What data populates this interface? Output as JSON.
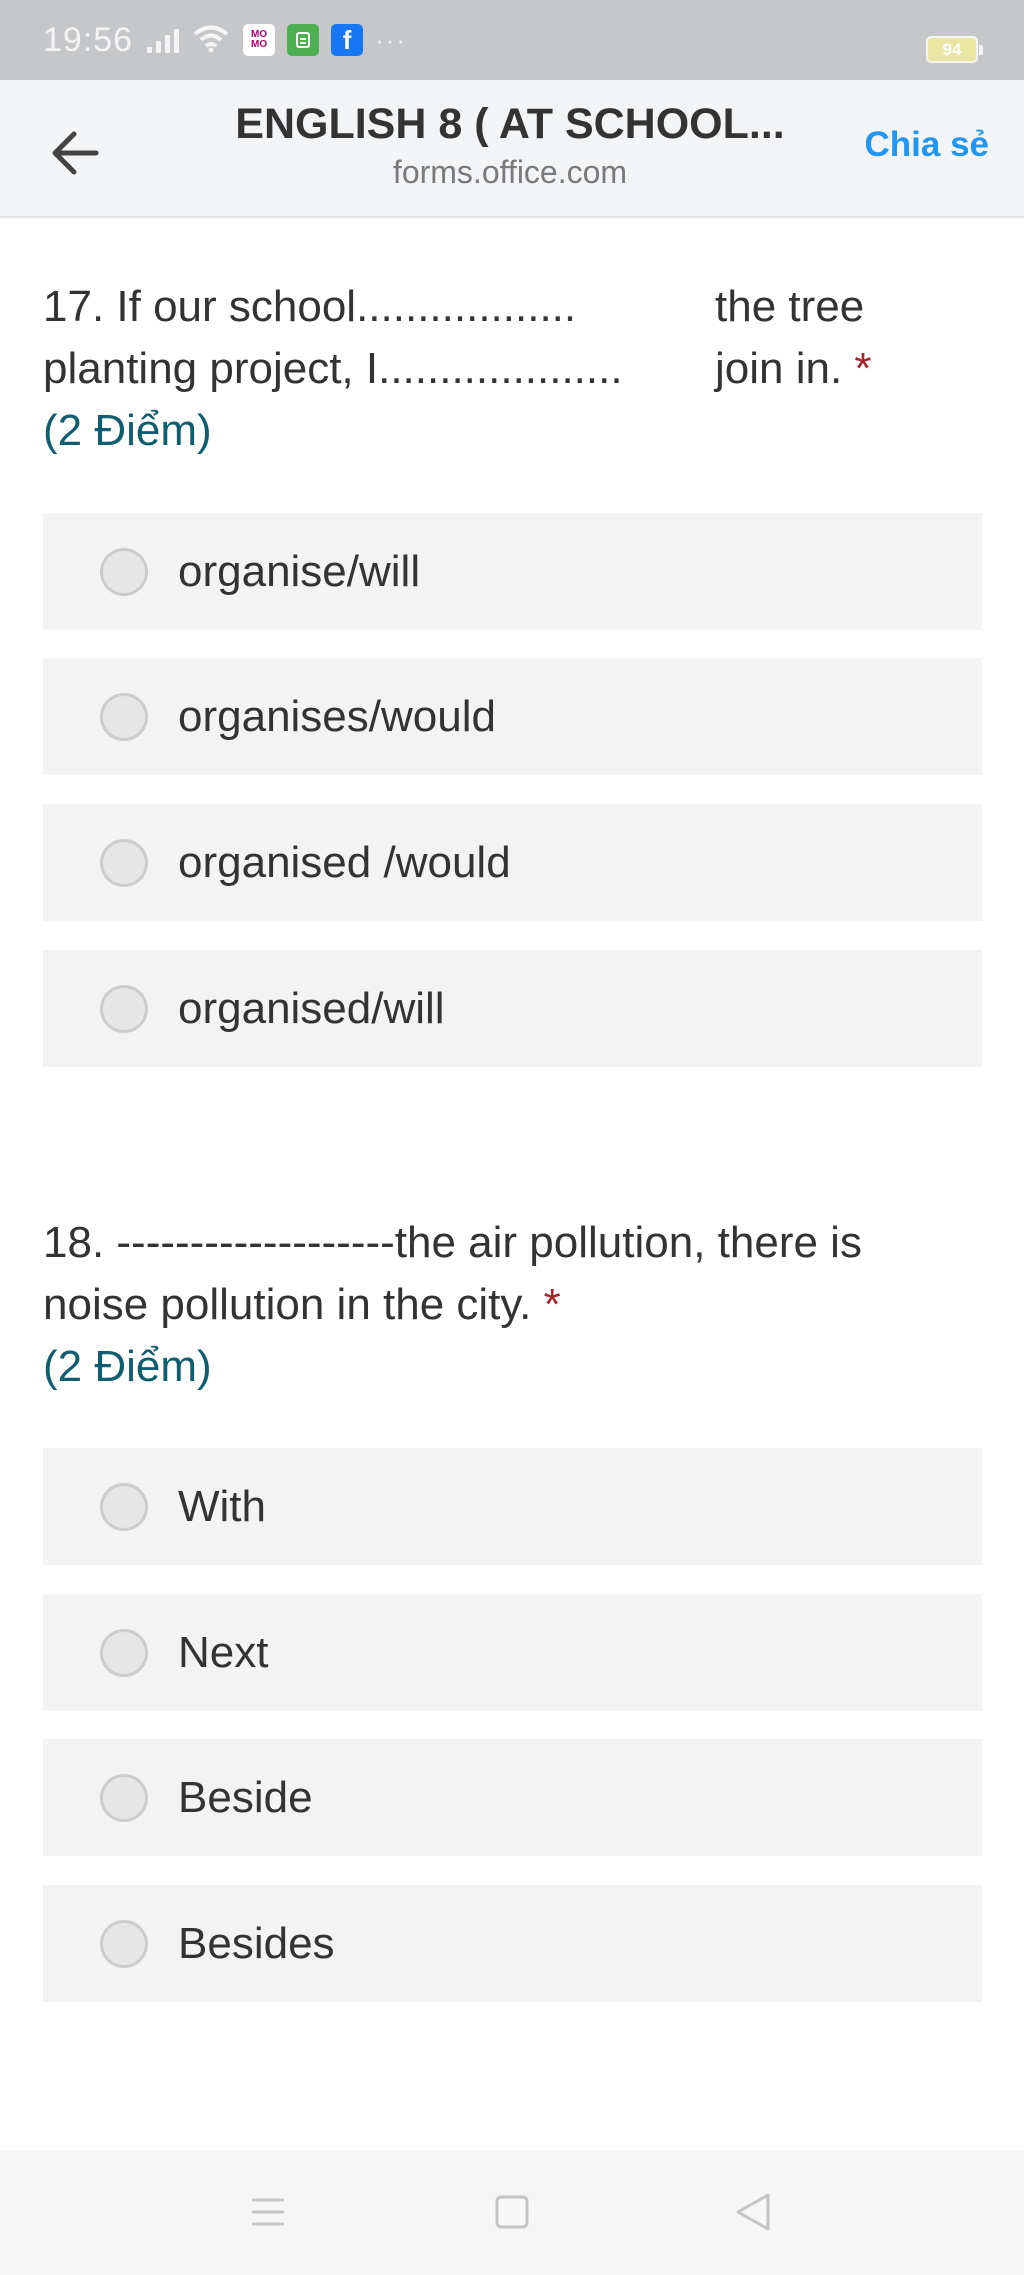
{
  "status_bar": {
    "time": "19:56",
    "dots": "···",
    "battery": "94",
    "icons": [
      "signal-icon",
      "wifi-icon",
      "momo-app-icon",
      "green-app-icon",
      "facebook-icon"
    ],
    "momo_label": "MO MO",
    "fb_label": "f"
  },
  "header": {
    "title": "ENGLISH 8 ( AT SCHOOL...",
    "url": "forms.office.com",
    "share_label": "Chia sẻ"
  },
  "questions": [
    {
      "line1_left": "17. If our school..................",
      "line1_right": "the tree",
      "line2_left": "planting project, I....................",
      "line2_right": "join in.",
      "required": "*",
      "points": "(2 Điểm)",
      "options": [
        "organise/will",
        "organises/would",
        "organised /would",
        "organised/will"
      ]
    },
    {
      "line1": "18. -------------------the air pollution, there is",
      "line2": "noise pollution in the city.",
      "required": "*",
      "points": "(2 Điểm)",
      "options": [
        "With",
        "Next",
        "Beside",
        "Besides"
      ]
    }
  ],
  "colors": {
    "accent": "#2196f3",
    "required": "#a4262c",
    "points": "#0e5e6f",
    "option_bg": "#f3f3f3"
  }
}
